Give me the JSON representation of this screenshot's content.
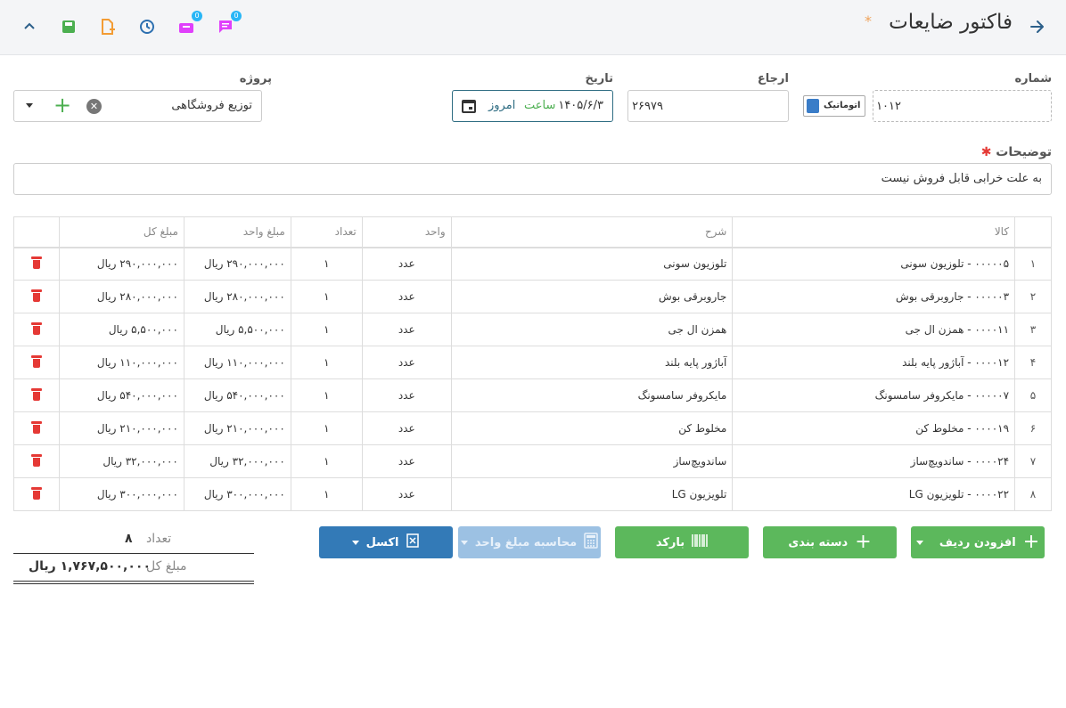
{
  "header": {
    "title": "فاکتور ضایعات",
    "required_mark": "*",
    "tools": [
      {
        "name": "chevron-up-icon"
      },
      {
        "name": "save-icon",
        "color": "#4caf50"
      },
      {
        "name": "add-file-icon",
        "color": "#f39c34"
      },
      {
        "name": "clock-icon",
        "color": "#2c6fb0"
      },
      {
        "name": "inbox-icon",
        "color": "#e040fb",
        "badge": "0"
      },
      {
        "name": "chat-icon",
        "color": "#e040fb",
        "badge": "0"
      }
    ]
  },
  "form": {
    "number_label": "شماره",
    "number_value": "۱۰۱۲",
    "auto_label": "اتوماتیک",
    "reference_label": "ارجاع",
    "reference_value": "۲۶۹۷۹",
    "date_label": "تاریخ",
    "date_value": "۱۴۰۵/۶/۳",
    "hour_label": "ساعت",
    "today_label": "امروز",
    "project_label": "پروژه",
    "project_value": "توزیع فروشگاهی",
    "description_label": "توضیحات",
    "description_value": "به علت خرابی قابل فروش نیست"
  },
  "table": {
    "columns": [
      "کالا",
      "شرح",
      "واحد",
      "تعداد",
      "مبلغ واحد",
      "مبلغ کل"
    ],
    "rows": [
      {
        "idx": "۱",
        "item": "۰۰۰۰۰۵ - تلوزیون سونی",
        "desc": "تلوزیون سونی",
        "unit": "عدد",
        "qty": "۱",
        "unit_price": "۲۹۰,۰۰۰,۰۰۰ ریال",
        "total": "۲۹۰,۰۰۰,۰۰۰ ریال"
      },
      {
        "idx": "۲",
        "item": "۰۰۰۰۰۳ - جاروبرقی بوش",
        "desc": "جاروبرقی بوش",
        "unit": "عدد",
        "qty": "۱",
        "unit_price": "۲۸۰,۰۰۰,۰۰۰ ریال",
        "total": "۲۸۰,۰۰۰,۰۰۰ ریال"
      },
      {
        "idx": "۳",
        "item": "۰۰۰۰۱۱ - همزن ال جی",
        "desc": "همزن ال جی",
        "unit": "عدد",
        "qty": "۱",
        "unit_price": "۵,۵۰۰,۰۰۰ ریال",
        "total": "۵,۵۰۰,۰۰۰ ریال"
      },
      {
        "idx": "۴",
        "item": "۰۰۰۰۱۲ - آباژور پایه بلند",
        "desc": "آباژور پایه بلند",
        "unit": "عدد",
        "qty": "۱",
        "unit_price": "۱۱۰,۰۰۰,۰۰۰ ریال",
        "total": "۱۱۰,۰۰۰,۰۰۰ ریال"
      },
      {
        "idx": "۵",
        "item": "۰۰۰۰۰۷ - مایکروفر سامسونگ",
        "desc": "مایکروفر سامسونگ",
        "unit": "عدد",
        "qty": "۱",
        "unit_price": "۵۴۰,۰۰۰,۰۰۰ ریال",
        "total": "۵۴۰,۰۰۰,۰۰۰ ریال"
      },
      {
        "idx": "۶",
        "item": "۰۰۰۰۱۹ - مخلوط کن",
        "desc": "مخلوط کن",
        "unit": "عدد",
        "qty": "۱",
        "unit_price": "۲۱۰,۰۰۰,۰۰۰ ریال",
        "total": "۲۱۰,۰۰۰,۰۰۰ ریال"
      },
      {
        "idx": "۷",
        "item": "۰۰۰۰۲۴ - ساندویچ‌ساز",
        "desc": "ساندویچ‌ساز",
        "unit": "عدد",
        "qty": "۱",
        "unit_price": "۳۲,۰۰۰,۰۰۰ ریال",
        "total": "۳۲,۰۰۰,۰۰۰ ریال"
      },
      {
        "idx": "۸",
        "item": "۰۰۰۰۲۲ - تلویزیون LG",
        "desc": "تلویزیون LG",
        "unit": "عدد",
        "qty": "۱",
        "unit_price": "۳۰۰,۰۰۰,۰۰۰ ریال",
        "total": "۳۰۰,۰۰۰,۰۰۰ ریال"
      }
    ]
  },
  "actions": {
    "add_row": "افزودن ردیف",
    "grouping": "دسته بندی",
    "barcode": "بارکد",
    "calc_unit_price": "محاسبه مبلغ واحد",
    "excel": "اکسل"
  },
  "totals": {
    "count_label": "تعداد",
    "count_value": "۸",
    "amount_label": "مبلغ کل",
    "amount_value": "۱,۷۶۷,۵۰۰,۰۰۰ ریال"
  }
}
